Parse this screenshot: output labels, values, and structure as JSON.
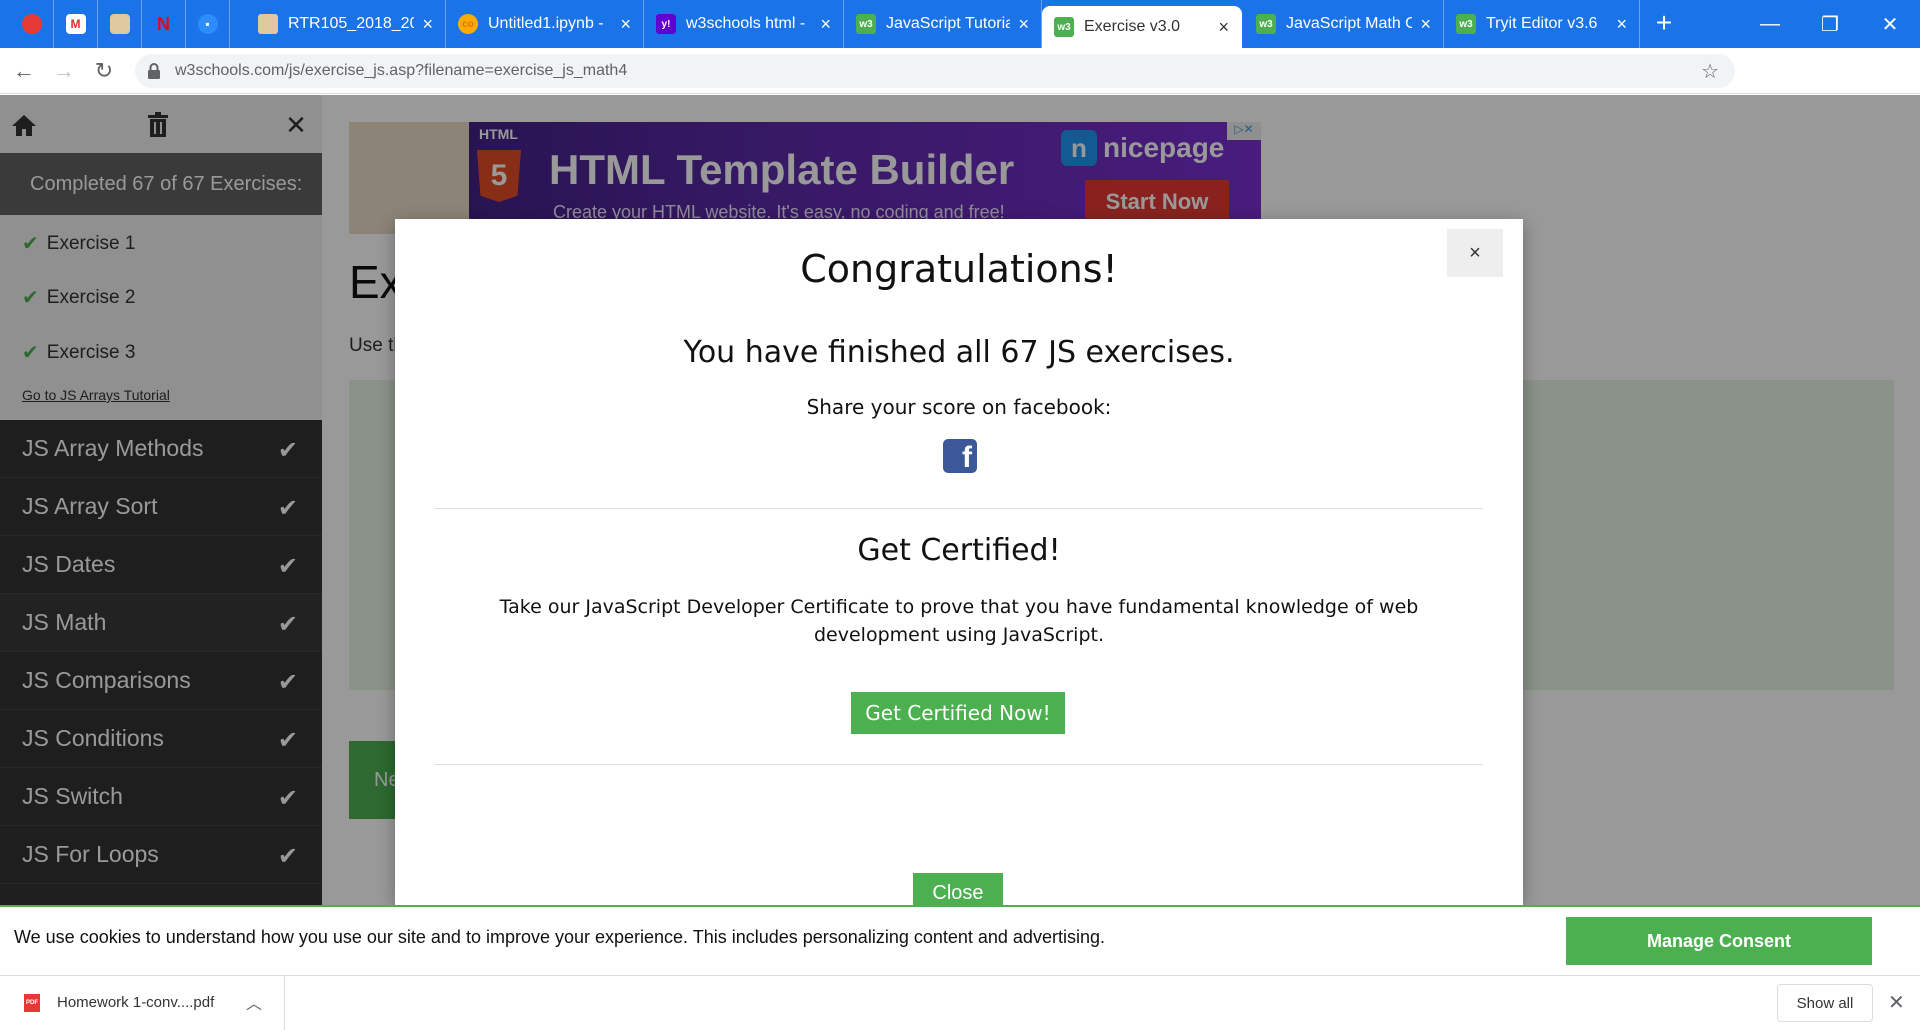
{
  "browser": {
    "tabs": [
      {
        "title": "RTR105_2018_201",
        "favicon": "image-icon",
        "active": false
      },
      {
        "title": "Untitled1.ipynb -",
        "favicon": "colab-icon",
        "active": false
      },
      {
        "title": "w3schools html -",
        "favicon": "yahoo-icon",
        "active": false
      },
      {
        "title": "JavaScript Tutorial",
        "favicon": "w3schools-icon",
        "active": false
      },
      {
        "title": "Exercise v3.0",
        "favicon": "w3schools-icon",
        "active": true
      },
      {
        "title": "JavaScript Math O",
        "favicon": "w3schools-icon",
        "active": false
      },
      {
        "title": "Tryit Editor v3.6",
        "favicon": "w3schools-icon",
        "active": false
      }
    ],
    "new_tab": "+",
    "url": "w3schools.com/js/exercise_js.asp?filename=exercise_js_math4",
    "accent": "#1b73e8"
  },
  "sidebar": {
    "completed": "Completed 67 of 67 Exercises:",
    "exercises": [
      "Exercise 1",
      "Exercise 2",
      "Exercise 3"
    ],
    "goto_link": "Go to JS Arrays Tutorial",
    "chapters": [
      "JS Array Methods",
      "JS Array Sort",
      "JS Dates",
      "JS Math",
      "JS Comparisons",
      "JS Conditions",
      "JS Switch",
      "JS For Loops"
    ]
  },
  "ad": {
    "label": "HTML",
    "logo_text": "5",
    "title": "HTML Template Builder",
    "subtitle": "Create your HTML website. It's easy, no coding and free!",
    "brand_mark": "n",
    "brand": "nicepage",
    "cta": "Start Now"
  },
  "main": {
    "title": "Exercise:",
    "text": "Use the",
    "next_label": "Next"
  },
  "modal": {
    "close_x": "×",
    "heading": "Congratulations!",
    "finished": "You have finished all 67 JS exercises.",
    "share": "Share your score on facebook:",
    "facebook_glyph": "f",
    "cert_heading": "Get Certified!",
    "cert_body": "Take our JavaScript Developer Certificate to prove that you have fundamental knowledge of web development using JavaScript.",
    "cert_button": "Get Certified Now!",
    "close_button": "Close",
    "accent": "#4caf50"
  },
  "cookie": {
    "text": "We use cookies to understand how you use our site and to improve your experience. This includes personalizing content and advertising.",
    "button": "Manage Consent"
  },
  "downloads": {
    "file": "Homework 1-conv....pdf",
    "file_type": "PDF",
    "show_all": "Show all"
  }
}
